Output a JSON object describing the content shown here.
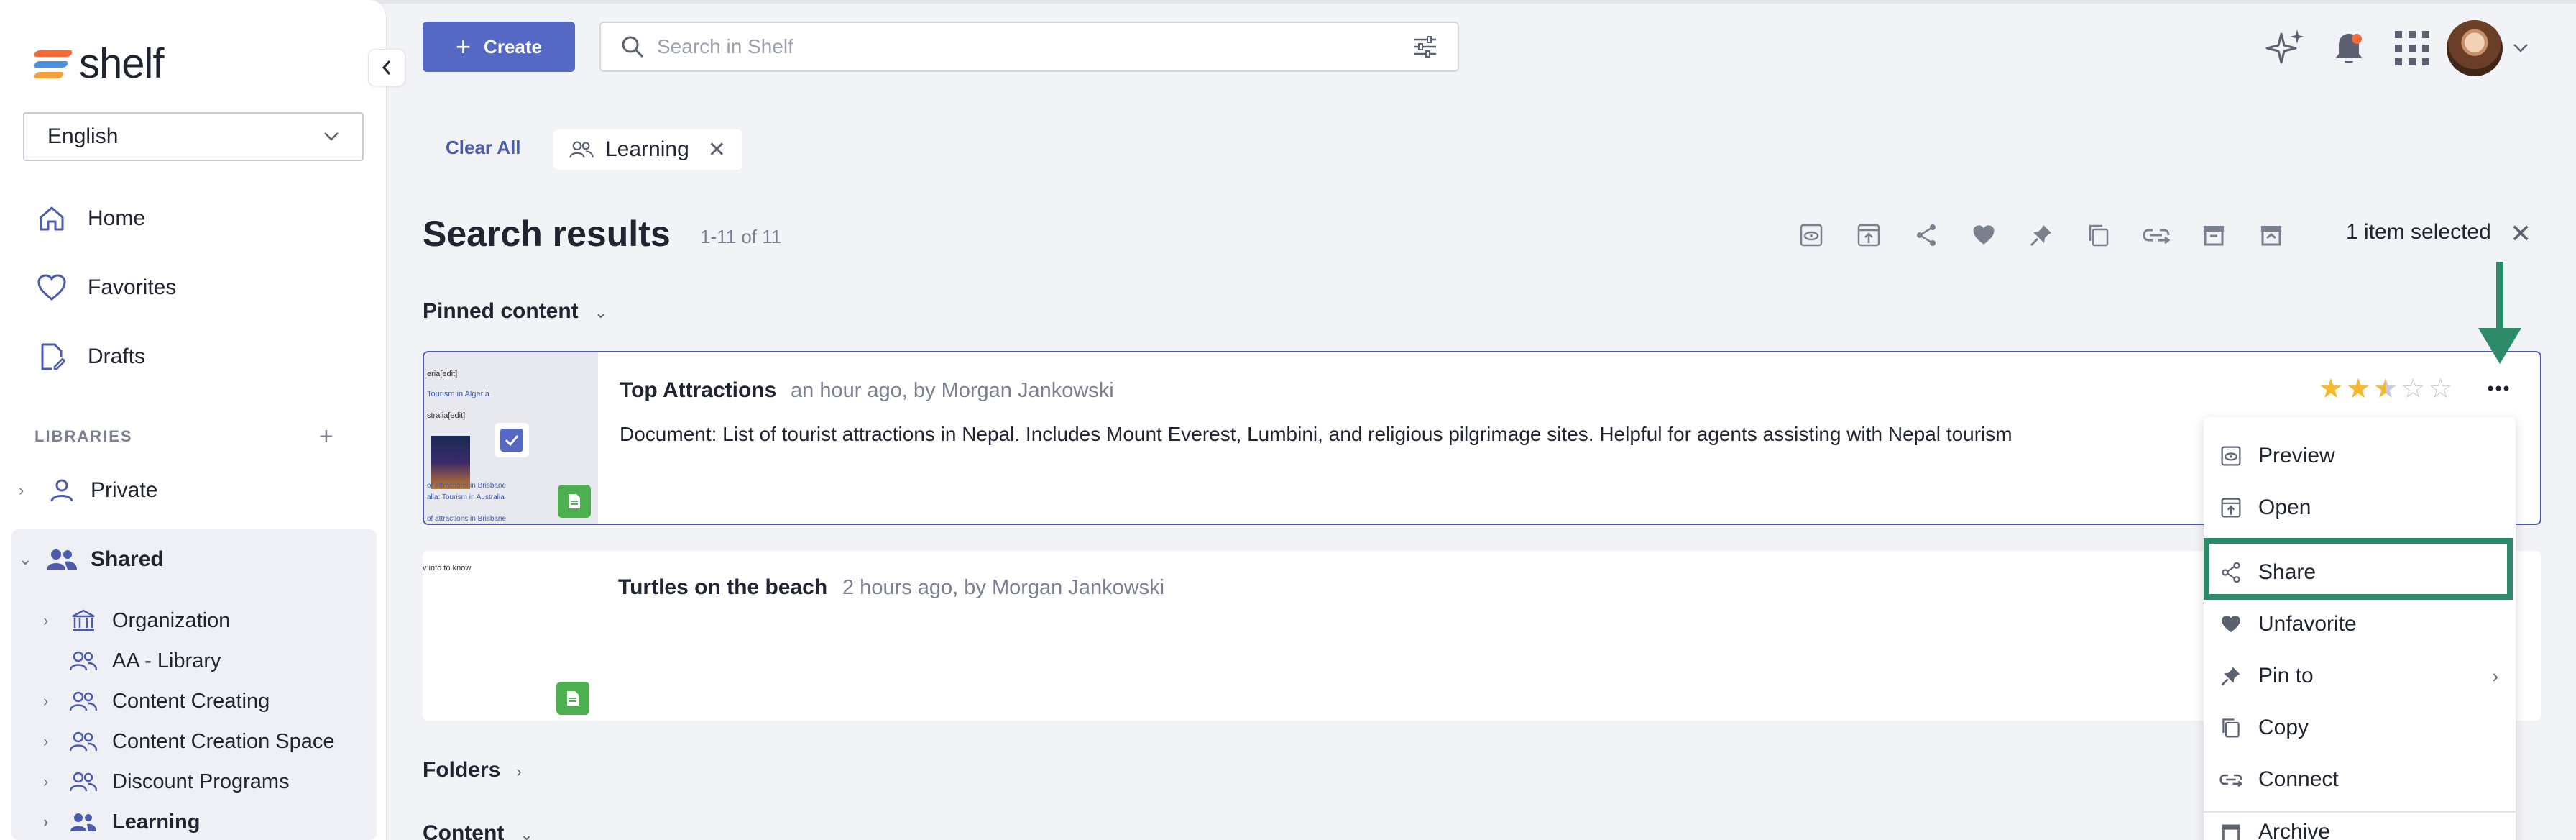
{
  "brand": {
    "name": "shelf"
  },
  "sidebar": {
    "language": "English",
    "nav": [
      {
        "label": "Home",
        "icon": "home-icon"
      },
      {
        "label": "Favorites",
        "icon": "heart-icon"
      },
      {
        "label": "Drafts",
        "icon": "draft-icon"
      }
    ],
    "libraries_label": "LIBRARIES",
    "libraries": [
      {
        "label": "Private",
        "icon": "user-icon"
      },
      {
        "label": "Shared",
        "icon": "users-icon"
      }
    ],
    "shared_children": [
      {
        "label": "Organization",
        "icon": "building-icon"
      },
      {
        "label": "AA - Library",
        "icon": "users-icon"
      },
      {
        "label": "Content Creating",
        "icon": "users-icon"
      },
      {
        "label": "Content Creation Space",
        "icon": "users-icon"
      },
      {
        "label": "Discount Programs",
        "icon": "users-icon"
      },
      {
        "label": "Learning",
        "icon": "users-icon"
      }
    ]
  },
  "topbar": {
    "create_label": "Create",
    "search_placeholder": "Search in Shelf"
  },
  "filters": {
    "clear_all": "Clear All",
    "chip_label": "Learning"
  },
  "results": {
    "title": "Search results",
    "count": "1-11 of 11",
    "selected_label": "1 item selected",
    "pinned_label": "Pinned content",
    "folders_label": "Folders",
    "content_label": "Content"
  },
  "cards": [
    {
      "title": "Top Attractions",
      "meta": "an hour ago, by Morgan Jankowski",
      "description": "Document: List of tourist attractions in Nepal. Includes Mount Everest, Lumbini, and religious pilgrimage sites. Helpful for agents assisting with Nepal tourism",
      "rating": 2.5,
      "thumb_lines": [
        "eria[edit]",
        "Tourism in Algeria",
        "stralia[edit]",
        "of attractions in Brisbane",
        "alia: Tourism in Australia",
        "of attractions in Brisbane"
      ]
    },
    {
      "title": "Turtles on the beach",
      "meta": "2 hours ago, by Morgan Jankowski",
      "thumb_text": "v info to know"
    }
  ],
  "menu": [
    {
      "label": "Preview",
      "icon": "eye-icon"
    },
    {
      "label": "Open",
      "icon": "open-icon"
    },
    {
      "label": "Share",
      "icon": "share-icon"
    },
    {
      "label": "Unfavorite",
      "icon": "heart-filled-icon"
    },
    {
      "label": "Pin to",
      "icon": "pin-icon"
    },
    {
      "label": "Copy",
      "icon": "copy-icon"
    },
    {
      "label": "Connect",
      "icon": "link-icon"
    },
    {
      "label": "Archive",
      "icon": "archive-icon"
    }
  ],
  "colors": {
    "accent": "#5468c4",
    "highlight": "#2e8b6a",
    "star": "#f5b82e"
  }
}
